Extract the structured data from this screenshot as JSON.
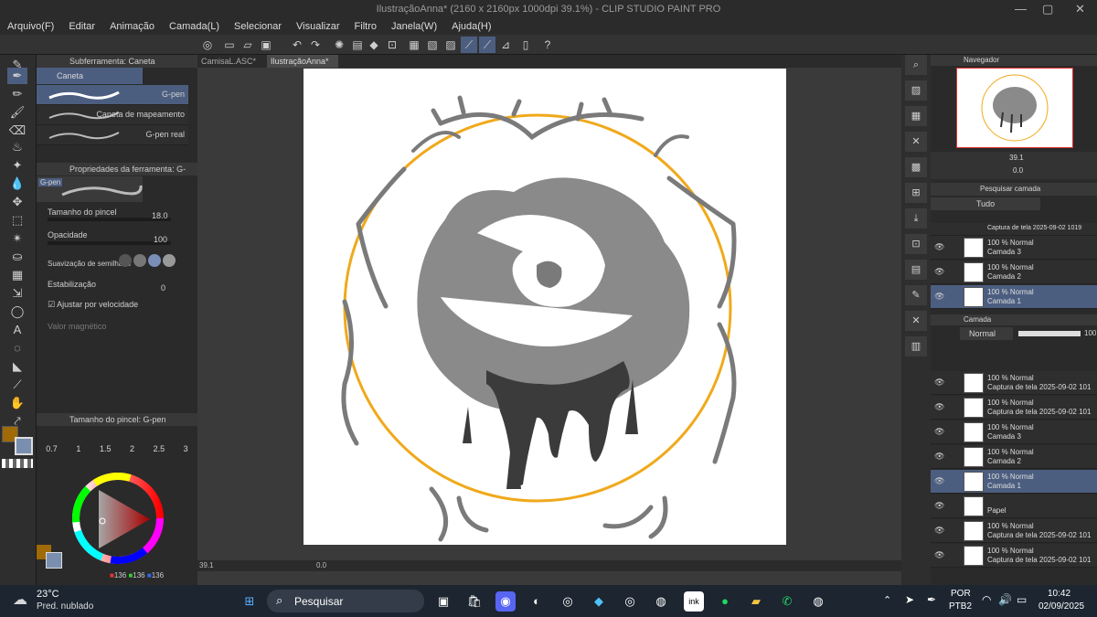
{
  "title": "IlustraçãoAnna* (2160 x 2160px 1000dpi 39.1%) - CLIP STUDIO PAINT PRO",
  "menu": [
    "Arquivo(F)",
    "Editar",
    "Animação",
    "Camada(L)",
    "Selecionar",
    "Visualizar",
    "Filtro",
    "Janela(W)",
    "Ajuda(H)"
  ],
  "tabs": [
    "CamisaL.ASC*",
    "IlustraçãoAnna*"
  ],
  "subtool": {
    "header": "Subferramenta: Caneta",
    "group": "Caneta",
    "items": [
      "G-pen",
      "Caneta de mapeamento",
      "G-pen real"
    ]
  },
  "toolprops": {
    "header": "Propriedades da ferramenta: G-pen",
    "preview_label": "G-pen",
    "brush_size_label": "Tamanho do pincel",
    "brush_size_value": "18.0",
    "opacity_label": "Opacidade",
    "opacity_value": "100",
    "smoothing_label": "Suavização de semilhado",
    "stabilization_label": "Estabilização",
    "stabilization_value": "0",
    "speed_label": "Ajustar por velocidade",
    "magnetic_label": "Valor magnético"
  },
  "brushsize": {
    "header": "Tamanho do pincel: G-pen",
    "values": [
      "0.7",
      "1",
      "1.5",
      "2",
      "2.5",
      "3"
    ]
  },
  "color": {
    "r": "136",
    "g": "136",
    "b": "136",
    "main": "#a06a08",
    "sub": "#7a8fb0"
  },
  "status": {
    "zoom": "39.1",
    "angle": "0.0"
  },
  "navigator": {
    "title": "Navegador",
    "zoom": "39.1",
    "angle": "0.0"
  },
  "layersearch": {
    "title": "Pesquisar camada",
    "filter": "Tudo"
  },
  "layer": {
    "title": "Camada",
    "blend": "Normal",
    "opacity": "100",
    "rows_top": [
      {
        "l1": "Captura de tela 2025-09-02 1019",
        "l2": ""
      },
      {
        "l1": "100 % Normal",
        "l2": "Camada 3"
      },
      {
        "l1": "100 % Normal",
        "l2": "Camada 2"
      },
      {
        "l1": "100 % Normal",
        "l2": "Camada 1"
      }
    ],
    "rows": [
      {
        "l1": "100 % Normal",
        "l2": "Captura de tela 2025-09-02 101"
      },
      {
        "l1": "100 % Normal",
        "l2": "Captura de tela 2025-09-02 101"
      },
      {
        "l1": "100 % Normal",
        "l2": "Camada 3"
      },
      {
        "l1": "100 % Normal",
        "l2": "Camada 2"
      },
      {
        "l1": "100 % Normal",
        "l2": "Camada 1"
      },
      {
        "l1": "",
        "l2": "Papel"
      },
      {
        "l1": "100 % Normal",
        "l2": "Captura de tela 2025-09-02 101"
      },
      {
        "l1": "100 % Normal",
        "l2": "Captura de tela 2025-09-02 101"
      }
    ]
  },
  "taskbar": {
    "weather_temp": "23°C",
    "weather_desc": "Pred. nublado",
    "search": "Pesquisar",
    "lang1": "POR",
    "lang2": "PTB2",
    "time": "10:42",
    "date": "02/09/2025"
  }
}
